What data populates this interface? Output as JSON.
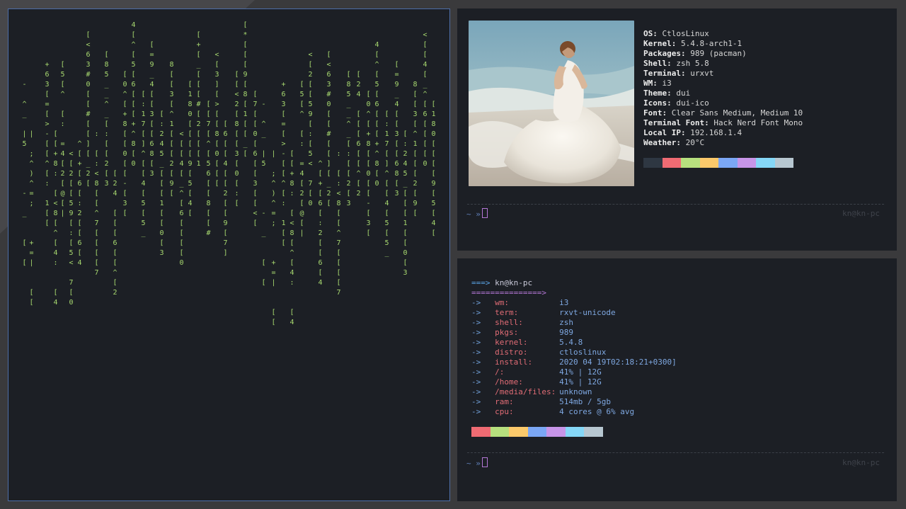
{
  "colors": {
    "accent_blue": "#4d6ea8",
    "matrix_green": "#a7d86f",
    "palette": [
      "#2e3742",
      "#ef6b73",
      "#b7e07e",
      "#fbc96b",
      "#7ba7f5",
      "#c795e8",
      "#85d7f7",
      "#b7c7d1"
    ],
    "palette2": [
      "#ef6b73",
      "#b7e07e",
      "#fbc96b",
      "#7ba7f5",
      "#c795e8",
      "#85d7f7",
      "#b7c7d1"
    ]
  },
  "matrix": {
    "columns": [
      "      -  ^ _  | 5     -  _   [  [",
      "    |  ; ^ ) ^ = ;    + = |   [ [",
      "  + 6 3 [ = [ > - [ [ ^ [ :  1 [ [",
      "  [ [ + 8 :  [ < 8 [ ^ [ 4 :   [ 4",
      "[ 5 [ ^  [ :  = 4 [ 2 [ @ [ |",
      "  < [ 2 [ [ 5 9 [ : [ 5 <  7 [ 0",
      "      ^ [ + [ 6 [ : 2 [ [ 6 [ 4",
      "[ < 6 3 # 0 [ [ # [ [ ] [ _ 2 [",
      "   :  [ : < 8 [ [ ^ 7 [ [ [ [ 7",
      "[ 8 5 _ _ ^ _ [ : [ [ 2 [ 3",
      "     [ 2 4  [ [ [ 6 [ [ ^ [ 2",
      "[ 0 ^ [ + 8 [ [ 0 [ [ - [ 3 [",
      "4 [ ^ [ 5 [ 6 [ [ [ + ^ 8 [ 0",
      "[ : 1 7 [ ] ^ [ [ 4 [ 5 [ 5 _",
      "[ = 9 _ 4 [ [ 3 [ [ 6 8 [ 3",
      "[ : 2 4 5 _ [ [ [ 1 [ [ 0 [ 3",
      "8 [ [ 3 [ ^ 1 [ [ [ 2 [ 9 [",
      "< [ [ 4 [ _ ^ [ 6 [ [ [ [ 0",
      "[ 1 8 0 [ [ [ [ 9 [ 5 [ 4 [",
      "[ + [ _ [ [ [ # [ 2 [ [ [ 1",
      "[ [ 7 [ ^ [ 5 6 [ [ 8 [ [ #",
      "< [ 3 ] [ > [ [ 8 [ 0 [ [ [",
      "[ 6 [ [ 4 [ [ 2 [ [ 9 [ 7 ]",
      "[ [ < 2 [ 8 [ [ 3 [ 0 [ : [",
      "[ * [ [ [ 9 [ 8 [ 1 [ [ _ [",
      "[ 7 [ [ 0 [ 6 [ [ 3 [ [ < ["
    ]
  },
  "neofetch": {
    "rows": [
      {
        "key": "OS",
        "value": "CtlosLinux"
      },
      {
        "key": "Kernel",
        "value": "5.4.8-arch1-1"
      },
      {
        "key": "Packages",
        "value": "989 (pacman)"
      },
      {
        "key": "Shell",
        "value": "zsh 5.8"
      },
      {
        "key": "Terminal",
        "value": "urxvt"
      },
      {
        "key": "WM",
        "value": "i3"
      },
      {
        "key": "Theme",
        "value": "dui"
      },
      {
        "key": "Icons",
        "value": "dui-ico"
      },
      {
        "key": "Font",
        "value": "Clear Sans Medium, Medium 10"
      },
      {
        "key": "Terminal Font",
        "value": "Hack Nerd Font Mono"
      },
      {
        "key": "Local IP",
        "value": "192.168.1.4"
      },
      {
        "key": "Weather",
        "value": "20°C"
      }
    ],
    "prompt": "~ »",
    "host": "kn@kn-pc"
  },
  "fetch": {
    "header_arrow": "===>",
    "header_user": "kn@kn-pc",
    "underline": "===============>",
    "rows": [
      {
        "key": "wm:",
        "value": "i3"
      },
      {
        "key": "term:",
        "value": "rxvt-unicode"
      },
      {
        "key": "shell:",
        "value": "zsh"
      },
      {
        "key": "pkgs:",
        "value": "989"
      },
      {
        "key": "kernel:",
        "value": "5.4.8"
      },
      {
        "key": "distro:",
        "value": "ctloslinux"
      },
      {
        "key": "install:",
        "value": "2020 04 19T02:18:21+0300]"
      },
      {
        "key": "/:",
        "value": "41% | 12G"
      },
      {
        "key": "/home:",
        "value": "41% | 12G"
      },
      {
        "key": "/media/files:",
        "value": "unknown"
      },
      {
        "key": "ram:",
        "value": "514mb / 5gb"
      },
      {
        "key": "cpu:",
        "value": "4 cores @ 6% avg"
      }
    ],
    "arrow": "->",
    "prompt": "~ »",
    "host": "kn@kn-pc"
  }
}
